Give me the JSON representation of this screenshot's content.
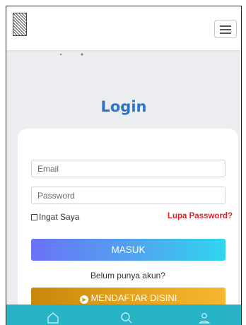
{
  "page": {
    "title": "Login"
  },
  "navbar": {
    "logo_icon": "woven-pattern-logo",
    "menu_icon": "hamburger-menu-icon"
  },
  "login_form": {
    "email_placeholder": "Email",
    "password_placeholder": "Password",
    "remember_label": "Ingat Saya",
    "forgot_label": "Lupa Password?",
    "submit_label": "MASUK",
    "no_account_text": "Belum punya akun?",
    "register_label": "MENDAFTAR DISINI",
    "register_icon": "arrow-right-circle-icon"
  },
  "bottom_nav": {
    "items": [
      {
        "icon": "home-icon"
      },
      {
        "icon": "search-icon"
      },
      {
        "icon": "user-icon"
      }
    ]
  },
  "colors": {
    "title": "#2e74c4",
    "forgot": "#e32027",
    "login_gradient": [
      "#6a72f7",
      "#2fd6ee"
    ],
    "register_gradient": [
      "#c8870a",
      "#f5b82e"
    ],
    "bottom_bar": "#27b4c7",
    "background": "#ebedf1"
  }
}
